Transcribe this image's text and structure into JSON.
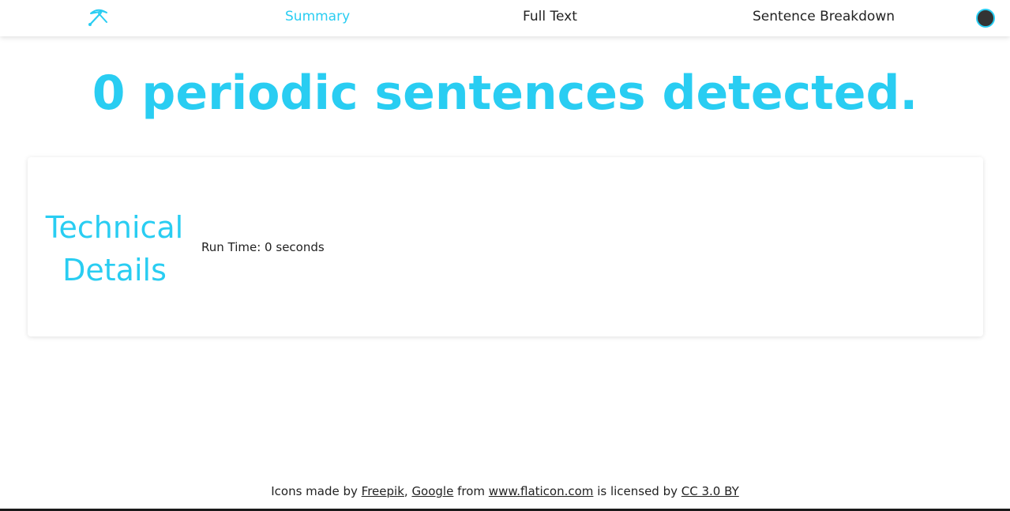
{
  "nav": {
    "logo_icon": "pickaxe-icon",
    "items": [
      {
        "label": "Summary",
        "active": true
      },
      {
        "label": "Full Text",
        "active": false
      },
      {
        "label": "Sentence Breakdown",
        "active": false
      }
    ],
    "theme_toggle_icon": "dark-mode-circle-icon"
  },
  "main": {
    "headline": "0 periodic sentences detected."
  },
  "technical": {
    "title_line1": "Technical",
    "title_line2": "Details",
    "run_time": "Run Time: 0 seconds"
  },
  "footer": {
    "prefix": "Icons made by ",
    "link1": "Freepik",
    "sep1": ", ",
    "link2": "Google",
    "mid": " from ",
    "link3": "www.flaticon.com",
    "mid2": " is licensed by ",
    "link4": "CC 3.0 BY"
  },
  "colors": {
    "accent": "#29cdf2",
    "text": "#222222",
    "toggle": "#333333"
  }
}
